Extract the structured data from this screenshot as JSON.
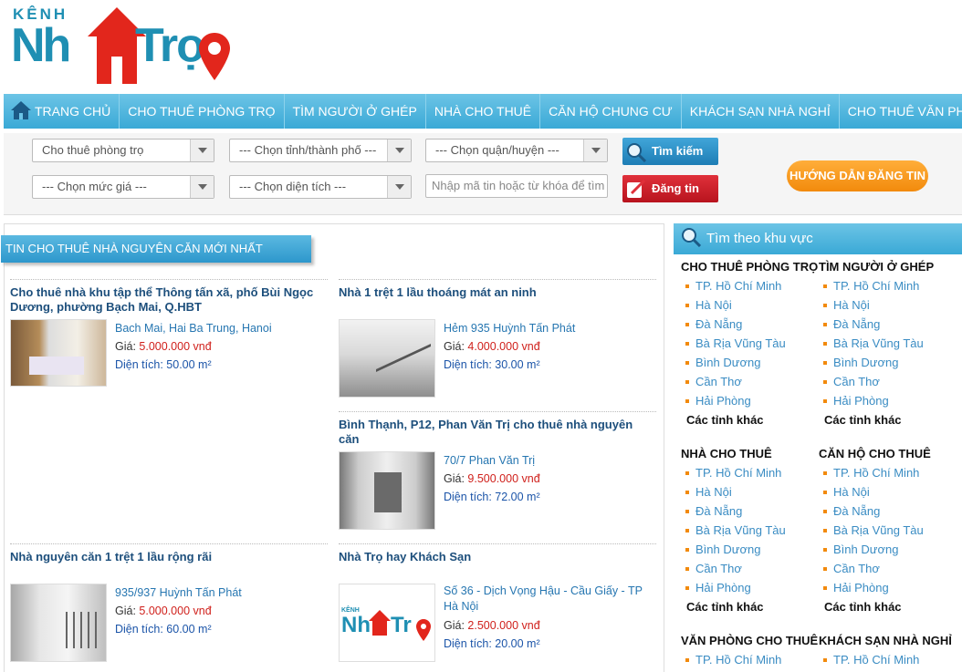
{
  "logo": {
    "kenh": "KÊNH",
    "nha": "Nh",
    "tro": "Trọ"
  },
  "nav": [
    "TRANG CHỦ",
    "CHO THUÊ PHÒNG TRỌ",
    "TÌM NGƯỜI Ở GHÉP",
    "NHÀ CHO THUÊ",
    "CĂN HỘ CHUNG CƯ",
    "KHÁCH SẠN NHÀ NGHỈ",
    "CHO THUÊ VĂN PHÒNG"
  ],
  "search": {
    "type": "Cho thuê phòng trọ",
    "province": "--- Chọn tỉnh/thành phố ---",
    "district": "--- Chọn quận/huyện ---",
    "price": "--- Chọn mức giá ---",
    "area": "--- Chọn diện tích ---",
    "keyword_placeholder": "Nhập mã tin hoặc từ khóa để tìm",
    "search_label": "Tìm kiếm",
    "post_label": "Đăng tin",
    "guide_label": "HƯỚNG DẪN ĐĂNG TIN"
  },
  "main": {
    "title": "TIN CHO THUÊ NHÀ NGUYÊN CĂN MỚI NHẤT",
    "price_label": "Giá:",
    "area_label": "Diện tích:",
    "posts": [
      {
        "title": "Cho thuê nhà khu tập thể Thông tấn xã, phố Bùi Ngọc Dương, phường Bạch Mai, Q.HBT",
        "address": "Bach Mai, Hai Ba Trung, Hanoi",
        "price": "5.000.000 vnđ",
        "area": "50.00 m²"
      },
      {
        "title": "Nhà 1 trệt 1 lầu thoáng mát an ninh",
        "address": "Hẻm 935 Huỳnh Tấn Phát",
        "price": "4.000.000 vnđ",
        "area": "30.00 m²"
      },
      {
        "title": "Bình Thạnh, P12, Phan Văn Trị cho thuê nhà nguyên căn",
        "address": "70/7 Phan Văn Trị",
        "price": "9.500.000 vnđ",
        "area": "72.00 m²"
      },
      {
        "title": "Nhà nguyên căn 1 trệt 1 lầu rộng rãi",
        "address": "935/937 Huỳnh Tấn Phát",
        "price": "5.000.000 vnđ",
        "area": "60.00 m²"
      },
      {
        "title": "Nhà Trọ hay Khách Sạn",
        "address": "Số 36 - Dịch Vọng Hậu - Cầu Giấy - TP Hà Nội",
        "price": "2.500.000 vnđ",
        "area": "20.00 m²"
      }
    ]
  },
  "sidebar": {
    "title": "Tìm theo khu vực",
    "cities": [
      "TP. Hồ Chí Minh",
      "Hà Nội",
      "Đà Nẵng",
      "Bà Rịa Vũng Tàu",
      "Bình Dương",
      "Cần Thơ",
      "Hải Phòng"
    ],
    "other": "Các tỉnh khác",
    "groups": [
      "CHO THUÊ PHÒNG TRỌ",
      "TÌM NGƯỜI Ở GHÉP",
      "NHÀ CHO THUÊ",
      "CĂN HỘ CHO THUÊ",
      "VĂN PHÒNG CHO THUÊ",
      "KHÁCH SẠN NHÀ NGHỈ"
    ],
    "last_city": "TP. Hồ Chí Minh"
  },
  "colors": {
    "nav": "#3aa9d6",
    "price": "#d0211c",
    "guide": "#f28a0c",
    "post_btn": "#c8202a"
  }
}
